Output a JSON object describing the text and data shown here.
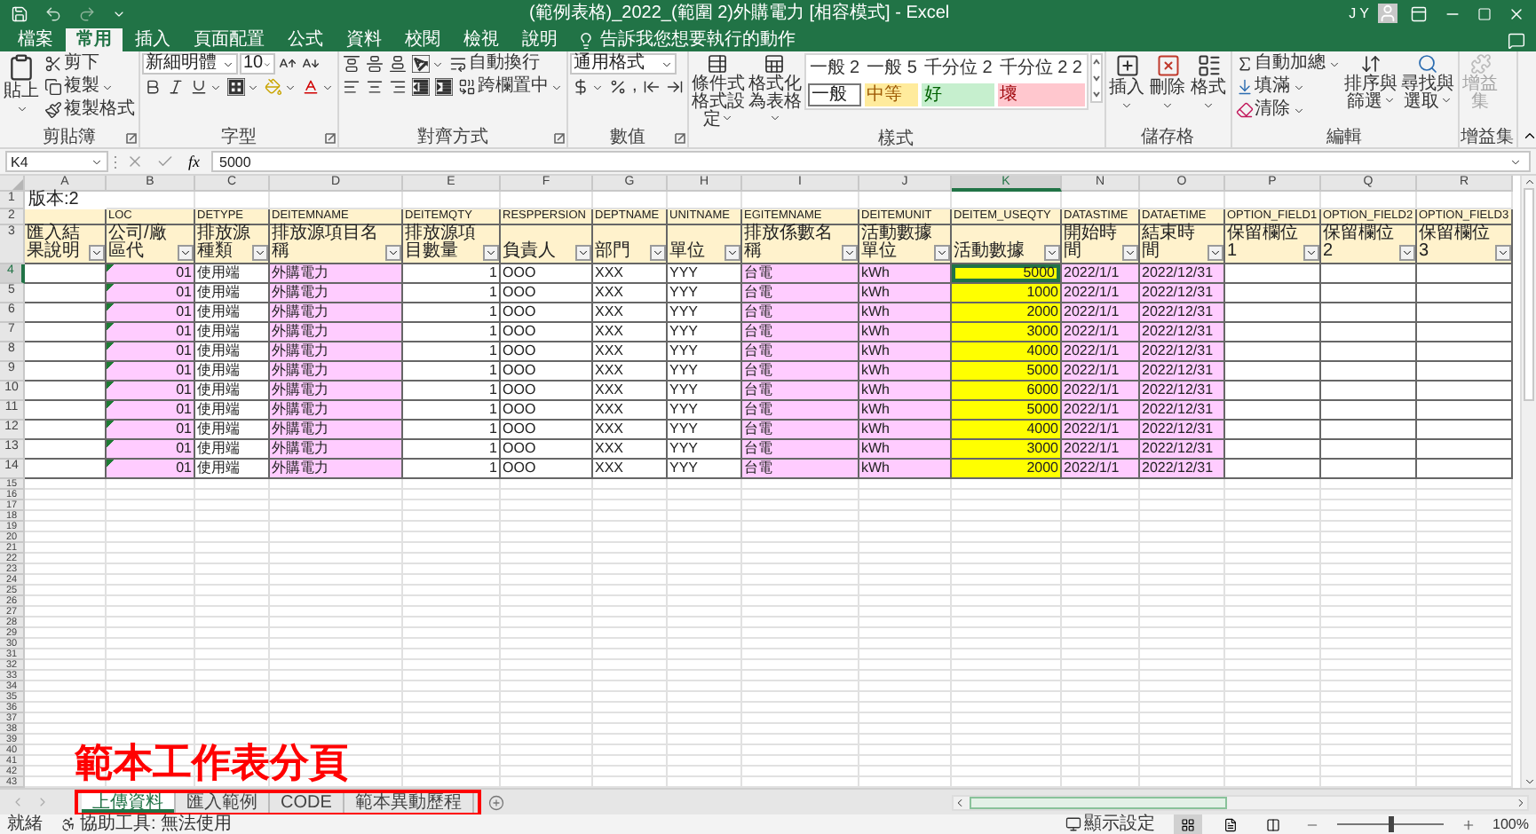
{
  "title_bar": {
    "title": "(範例表格)_2022_(範圍 2)外購電力 [相容模式] - Excel",
    "user": "J Y"
  },
  "ribbon_tabs": [
    {
      "label": "檔案",
      "selected": false
    },
    {
      "label": "常用",
      "selected": true
    },
    {
      "label": "插入",
      "selected": false
    },
    {
      "label": "頁面配置",
      "selected": false
    },
    {
      "label": "公式",
      "selected": false
    },
    {
      "label": "資料",
      "selected": false
    },
    {
      "label": "校閱",
      "selected": false
    },
    {
      "label": "檢視",
      "selected": false
    },
    {
      "label": "說明",
      "selected": false
    }
  ],
  "tell_me": "告訴我您想要執行的動作",
  "ribbon": {
    "clipboard": {
      "paste": "貼上",
      "cut": "剪下",
      "copy": "複製",
      "format_painter": "複製格式",
      "label": "剪貼簿"
    },
    "font": {
      "name": "新細明體",
      "size": "10",
      "label": "字型"
    },
    "alignment": {
      "wrap": "自動換行",
      "merge": "跨欄置中",
      "label": "對齊方式"
    },
    "number": {
      "format": "通用格式",
      "comma": ",",
      "label": "數值"
    },
    "styles": {
      "conditional": "條件式格式設定",
      "as_table": "格式化為表格",
      "label": "樣式",
      "gallery": [
        {
          "label": "一般 2",
          "kind": "plain"
        },
        {
          "label": "一般 5",
          "kind": "plain"
        },
        {
          "label": "千分位 2",
          "kind": "plain"
        },
        {
          "label": "千分位 2 2",
          "kind": "plain"
        },
        {
          "label": "一般",
          "kind": "boxed"
        },
        {
          "label": "中等",
          "kind": "neutral"
        },
        {
          "label": "好",
          "kind": "good"
        },
        {
          "label": "壞",
          "kind": "bad"
        }
      ]
    },
    "cells": {
      "insert": "插入",
      "delete": "刪除",
      "format": "格式",
      "label": "儲存格"
    },
    "editing": {
      "autosum": "自動加總",
      "fill": "填滿",
      "clear": "清除",
      "sort": "排序與篩選",
      "find": "尋找與選取",
      "label": "編輯"
    },
    "addins": {
      "button": "增益集",
      "label": "增益集",
      "disabled": true
    }
  },
  "formula_bar": {
    "name_box": "K4",
    "function_label": "fx",
    "value": "5000"
  },
  "sheet": {
    "columns": [
      {
        "letter": "A",
        "header": "匯入結果說明",
        "color": "#ffffff",
        "selected": false
      },
      {
        "letter": "B",
        "field": "LOC",
        "header": "公司/廠區代",
        "kind": "coded",
        "color": "#ffccff",
        "selected": false
      },
      {
        "letter": "C",
        "field": "DETYPE",
        "header": "排放源種類",
        "kind": "text",
        "color": "#ffffff",
        "selected": false
      },
      {
        "letter": "D",
        "field": "DEITEMNAME",
        "header": "排放源項目名稱",
        "kind": "text",
        "color": "#ffccff",
        "selected": false
      },
      {
        "letter": "E",
        "field": "DEITEMQTY",
        "header": "排放源項目數量",
        "kind": "number",
        "color": "#ffffff",
        "selected": false
      },
      {
        "letter": "F",
        "field": "RESPPERSION",
        "header": "負責人",
        "kind": "text",
        "color": "#ffffff",
        "selected": false
      },
      {
        "letter": "G",
        "field": "DEPTNAME",
        "header": "部門",
        "kind": "text",
        "color": "#ffffff",
        "selected": false
      },
      {
        "letter": "H",
        "field": "UNITNAME",
        "header": "單位",
        "kind": "text",
        "color": "#ffffff",
        "selected": false
      },
      {
        "letter": "I",
        "field": "EGITEMNAME",
        "header": "排放係數名稱",
        "kind": "text",
        "color": "#ffccff",
        "selected": false
      },
      {
        "letter": "J",
        "field": "DEITEMUNIT",
        "header": "活動數據單位",
        "kind": "text",
        "color": "#ffccff",
        "selected": false
      },
      {
        "letter": "K",
        "field": "DEITEM_USEQTY",
        "header": "活動數據",
        "kind": "number",
        "color": "#ffff00",
        "selected": true
      },
      {
        "letter": "N",
        "field": "DATASTIME",
        "header": "開始時間",
        "kind": "text",
        "color": "#ffccff",
        "selected": false
      },
      {
        "letter": "O",
        "field": "DATAETIME",
        "header": "結束時間",
        "kind": "text",
        "color": "#ffccff",
        "selected": false
      },
      {
        "letter": "P",
        "field": "OPTION_FIELD1",
        "header": "保留欄位1",
        "color": "#ffffff",
        "selected": false
      },
      {
        "letter": "Q",
        "field": "OPTION_FIELD2",
        "header": "保留欄位2",
        "color": "#ffffff",
        "selected": false
      },
      {
        "letter": "R",
        "field": "OPTION_FIELD3",
        "header": "保留欄位3",
        "color": "#ffffff",
        "selected": false
      }
    ],
    "title_row": {
      "number": "1",
      "version": "版本:2"
    },
    "field_row": {
      "number": "2"
    },
    "header_row": {
      "number": "3"
    },
    "rows": [
      {
        "number": "4",
        "selected": true,
        "cells": {
          "B": "01",
          "C": "使用端",
          "D": "外購電力",
          "E": "1",
          "F": "OOO",
          "G": "XXX",
          "H": "YYY",
          "I": "台電",
          "J": "kWh",
          "K": "5000",
          "N": "2022/1/1",
          "O": "2022/12/31"
        }
      },
      {
        "number": "5",
        "selected": false,
        "cells": {
          "B": "01",
          "C": "使用端",
          "D": "外購電力",
          "E": "1",
          "F": "OOO",
          "G": "XXX",
          "H": "YYY",
          "I": "台電",
          "J": "kWh",
          "K": "1000",
          "N": "2022/1/1",
          "O": "2022/12/31"
        }
      },
      {
        "number": "6",
        "selected": false,
        "cells": {
          "B": "01",
          "C": "使用端",
          "D": "外購電力",
          "E": "1",
          "F": "OOO",
          "G": "XXX",
          "H": "YYY",
          "I": "台電",
          "J": "kWh",
          "K": "2000",
          "N": "2022/1/1",
          "O": "2022/12/31"
        }
      },
      {
        "number": "7",
        "selected": false,
        "cells": {
          "B": "01",
          "C": "使用端",
          "D": "外購電力",
          "E": "1",
          "F": "OOO",
          "G": "XXX",
          "H": "YYY",
          "I": "台電",
          "J": "kWh",
          "K": "3000",
          "N": "2022/1/1",
          "O": "2022/12/31"
        }
      },
      {
        "number": "8",
        "selected": false,
        "cells": {
          "B": "01",
          "C": "使用端",
          "D": "外購電力",
          "E": "1",
          "F": "OOO",
          "G": "XXX",
          "H": "YYY",
          "I": "台電",
          "J": "kWh",
          "K": "4000",
          "N": "2022/1/1",
          "O": "2022/12/31"
        }
      },
      {
        "number": "9",
        "selected": false,
        "cells": {
          "B": "01",
          "C": "使用端",
          "D": "外購電力",
          "E": "1",
          "F": "OOO",
          "G": "XXX",
          "H": "YYY",
          "I": "台電",
          "J": "kWh",
          "K": "5000",
          "N": "2022/1/1",
          "O": "2022/12/31"
        }
      },
      {
        "number": "10",
        "selected": false,
        "cells": {
          "B": "01",
          "C": "使用端",
          "D": "外購電力",
          "E": "1",
          "F": "OOO",
          "G": "XXX",
          "H": "YYY",
          "I": "台電",
          "J": "kWh",
          "K": "6000",
          "N": "2022/1/1",
          "O": "2022/12/31"
        }
      },
      {
        "number": "11",
        "selected": false,
        "cells": {
          "B": "01",
          "C": "使用端",
          "D": "外購電力",
          "E": "1",
          "F": "OOO",
          "G": "XXX",
          "H": "YYY",
          "I": "台電",
          "J": "kWh",
          "K": "5000",
          "N": "2022/1/1",
          "O": "2022/12/31"
        }
      },
      {
        "number": "12",
        "selected": false,
        "cells": {
          "B": "01",
          "C": "使用端",
          "D": "外購電力",
          "E": "1",
          "F": "OOO",
          "G": "XXX",
          "H": "YYY",
          "I": "台電",
          "J": "kWh",
          "K": "4000",
          "N": "2022/1/1",
          "O": "2022/12/31"
        }
      },
      {
        "number": "13",
        "selected": false,
        "cells": {
          "B": "01",
          "C": "使用端",
          "D": "外購電力",
          "E": "1",
          "F": "OOO",
          "G": "XXX",
          "H": "YYY",
          "I": "台電",
          "J": "kWh",
          "K": "3000",
          "N": "2022/1/1",
          "O": "2022/12/31"
        }
      },
      {
        "number": "14",
        "selected": false,
        "cells": {
          "B": "01",
          "C": "使用端",
          "D": "外購電力",
          "E": "1",
          "F": "OOO",
          "G": "XXX",
          "H": "YYY",
          "I": "台電",
          "J": "kWh",
          "K": "2000",
          "N": "2022/1/1",
          "O": "2022/12/31"
        }
      }
    ],
    "empty_rows": [
      "15",
      "16",
      "17",
      "18",
      "19",
      "20",
      "21",
      "22",
      "23",
      "24",
      "25",
      "26",
      "27",
      "28",
      "29",
      "30",
      "31",
      "32",
      "33",
      "34",
      "35",
      "36",
      "37",
      "38",
      "39",
      "40",
      "41",
      "42",
      "43"
    ]
  },
  "annotation": "範本工作表分頁",
  "sheet_tabs": [
    {
      "label": "上傳資料",
      "selected": true
    },
    {
      "label": "匯入範例",
      "selected": false
    },
    {
      "label": "CODE",
      "selected": false
    },
    {
      "label": "範本異動歷程",
      "selected": false
    }
  ],
  "status_bar": {
    "ready": "就緒",
    "accessibility": "協助工具: 無法使用",
    "display_settings": "顯示設定",
    "views": [
      {
        "kind": "normal",
        "selected": true
      },
      {
        "kind": "layout",
        "selected": false
      },
      {
        "kind": "break",
        "selected": false
      }
    ],
    "zoom_slider": {
      "level": 0.5
    },
    "zoom": "100%"
  }
}
